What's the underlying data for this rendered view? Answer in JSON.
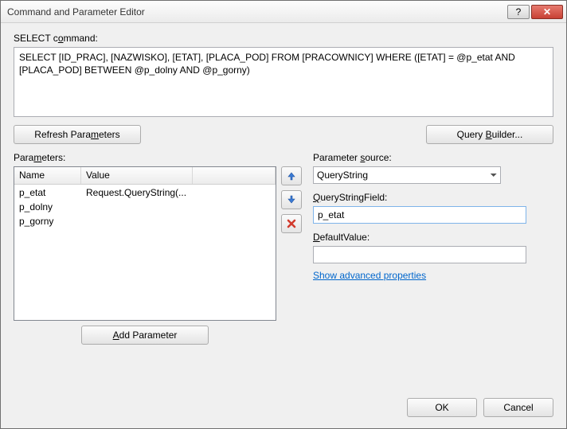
{
  "window": {
    "title": "Command and Parameter Editor"
  },
  "labels": {
    "select_command_pre": "SELECT c",
    "select_command_u": "o",
    "select_command_post": "mmand:",
    "parameters_pre": "Para",
    "parameters_u": "m",
    "parameters_post": "eters:",
    "param_source_pre": "Parameter ",
    "param_source_u": "s",
    "param_source_post": "ource:",
    "qsf_u": "Q",
    "qsf_post": "ueryStringField:",
    "default_u": "D",
    "default_post": "efaultValue:"
  },
  "sql": "SELECT [ID_PRAC], [NAZWISKO], [ETAT], [PLACA_POD] FROM [PRACOWNICY] WHERE ([ETAT] = @p_etat AND [PLACA_POD] BETWEEN @p_dolny AND @p_gorny)",
  "buttons": {
    "refresh_pre": "Refresh Para",
    "refresh_u": "m",
    "refresh_post": "eters",
    "query_builder_pre": "Query ",
    "query_builder_u": "B",
    "query_builder_post": "uilder...",
    "add_param_u": "A",
    "add_param_post": "dd Parameter",
    "ok": "OK",
    "cancel": "Cancel"
  },
  "grid": {
    "head_name": "Name",
    "head_value": "Value",
    "rows": [
      {
        "name": "p_etat",
        "value": "Request.QueryString(..."
      },
      {
        "name": "p_dolny",
        "value": ""
      },
      {
        "name": "p_gorny",
        "value": ""
      }
    ]
  },
  "source": {
    "selected": "QueryString"
  },
  "qsf": {
    "value": "p_etat"
  },
  "defaultv": {
    "value": ""
  },
  "link": {
    "advanced": "Show advanced properties"
  }
}
